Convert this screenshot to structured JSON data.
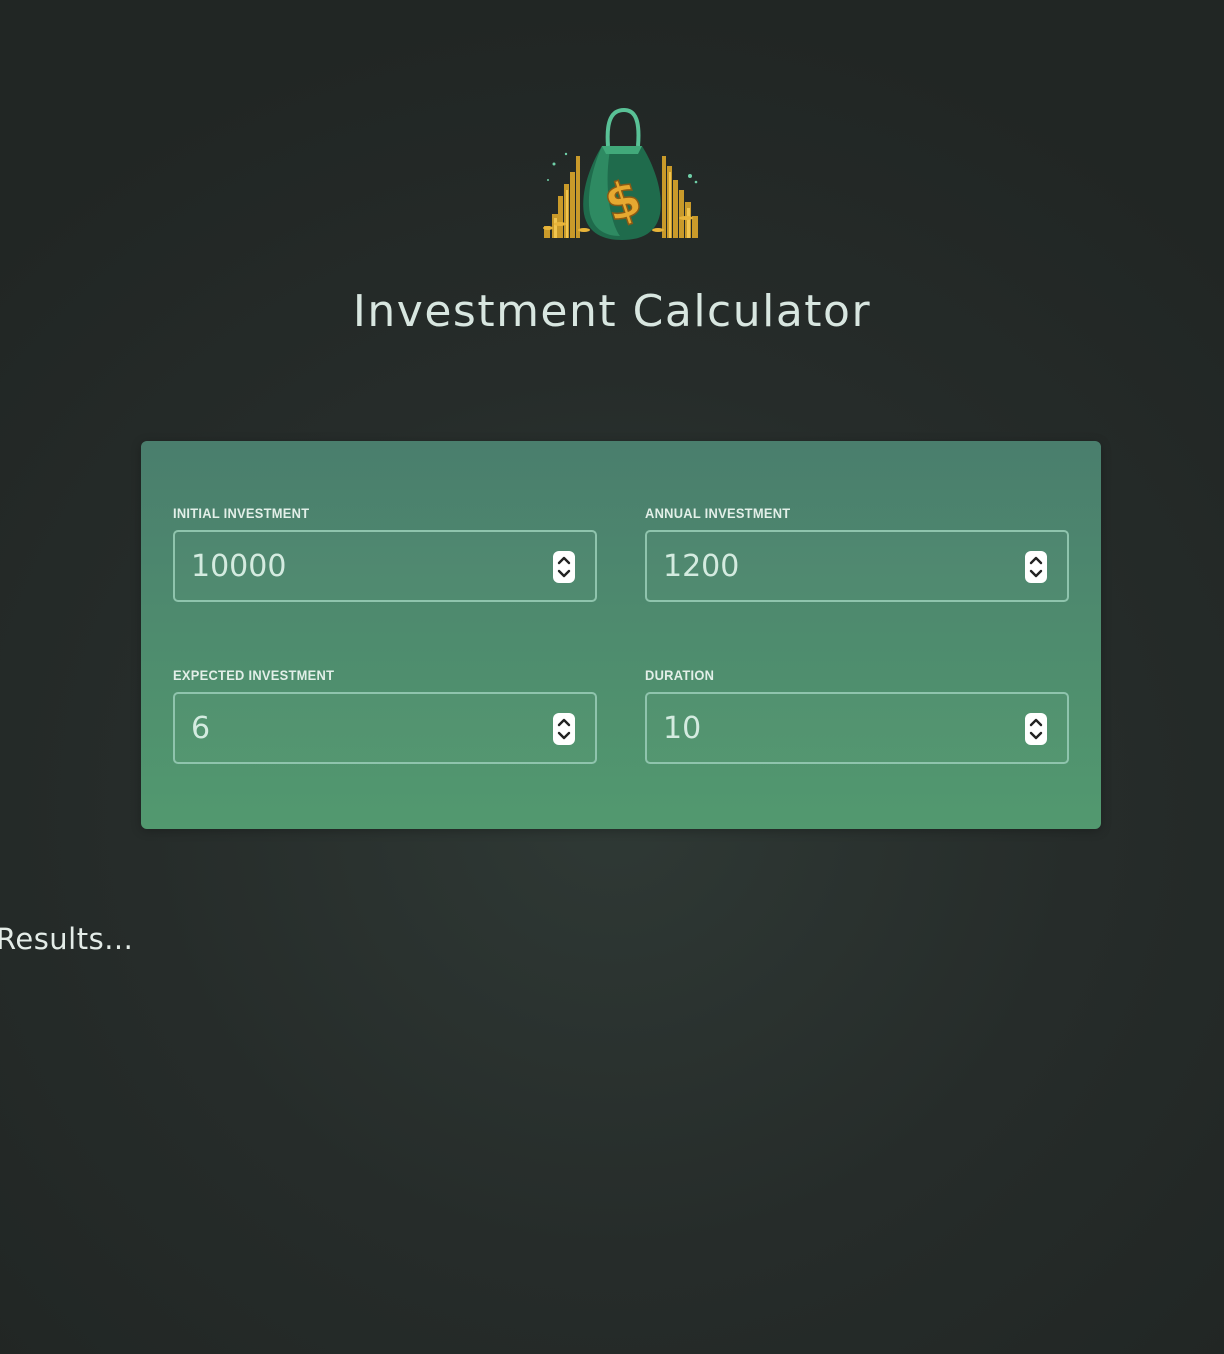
{
  "header": {
    "logo_icon": "money-bag-logo",
    "title": "Investment Calculator"
  },
  "form": {
    "fields": [
      {
        "label": "INITIAL INVESTMENT",
        "value": "10000"
      },
      {
        "label": "ANNUAL INVESTMENT",
        "value": "1200"
      },
      {
        "label": "EXPECTED INVESTMENT",
        "value": "6"
      },
      {
        "label": "DURATION",
        "value": "10"
      }
    ]
  },
  "results": {
    "text": "Results..."
  },
  "colors": {
    "background": "#262c2a",
    "panel_top": "#4a7e6d",
    "panel_bottom": "#52996f",
    "input_border": "#8fc4ad",
    "gold": "#d9a22b"
  }
}
